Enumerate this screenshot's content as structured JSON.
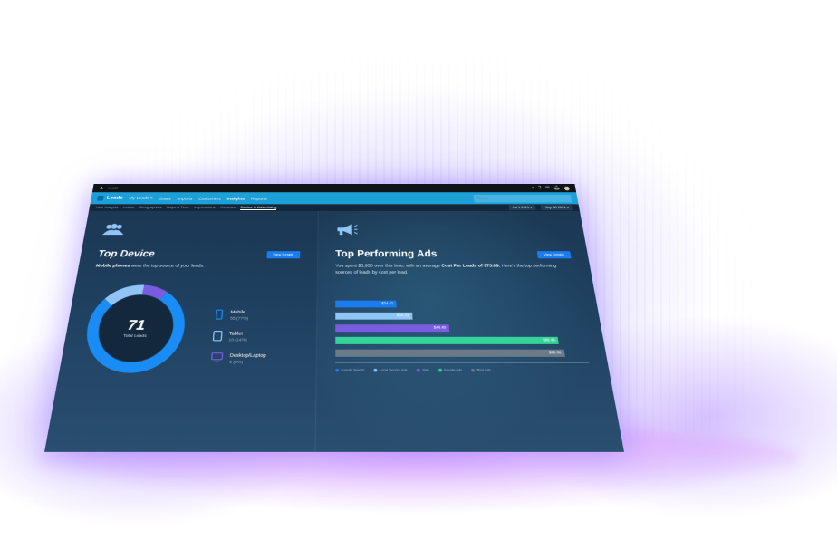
{
  "window": {
    "app_name": "Leads"
  },
  "nav": {
    "brand": "Leads",
    "items": [
      "My Leads ▾",
      "Goals",
      "Imports",
      "Customers",
      "Insights",
      "Reports"
    ],
    "active_index": 4,
    "search_placeholder": "Search"
  },
  "subnav": {
    "tabs": [
      "Your Insights",
      "Leads",
      "Geographies",
      "Days & Time",
      "Impressions",
      "Reviews",
      "Device & Advertising"
    ],
    "active_index": 6,
    "date_from": "Jul 1 2021 ▾",
    "date_to": "Sep 30 2021 ▾"
  },
  "top_device": {
    "title": "Top Device",
    "button": "View Details",
    "subtitle_bold": "Mobile phones",
    "subtitle_rest": " were the top source of your leads.",
    "total": "71",
    "total_label": "Total Leads",
    "devices": [
      {
        "name": "Mobile",
        "value": "55 (77%)",
        "icon": "mobile-icon"
      },
      {
        "name": "Tablet",
        "value": "10 (14%)",
        "icon": "tablet-icon"
      },
      {
        "name": "Desktop/Laptop",
        "value": "6 (8%)",
        "icon": "desktop-icon"
      }
    ]
  },
  "top_ads": {
    "title": "Top Performing Ads",
    "button": "View Details",
    "subtitle_pre": "You spent $3,950 over this time, with an average ",
    "subtitle_bold": "Cost Per Leads of $73.89.",
    "subtitle_post": " Here's the top performing sources of leads by cost per lead."
  },
  "chart_data": {
    "type": "bar",
    "orientation": "horizontal",
    "categories": [
      "Google Search",
      "Local Service Ads",
      "Yelp",
      "Google Ads",
      "Bing Ads"
    ],
    "values": [
      24.41,
      30.23,
      44.49,
      86.48,
      88.08
    ],
    "labels": [
      "$24.41",
      "$30.23",
      "$44.49",
      "$86.48",
      "$88.08"
    ],
    "colors": [
      "#1a7cf0",
      "#8fc4f5",
      "#7a5ce0",
      "#35d39a",
      "#6b7a88"
    ],
    "legend_placement": "bottom"
  },
  "donut_data": {
    "values": [
      55,
      10,
      6
    ],
    "colors": [
      "#1a8cf5",
      "#8fc4f5",
      "#7a5ce0"
    ]
  }
}
